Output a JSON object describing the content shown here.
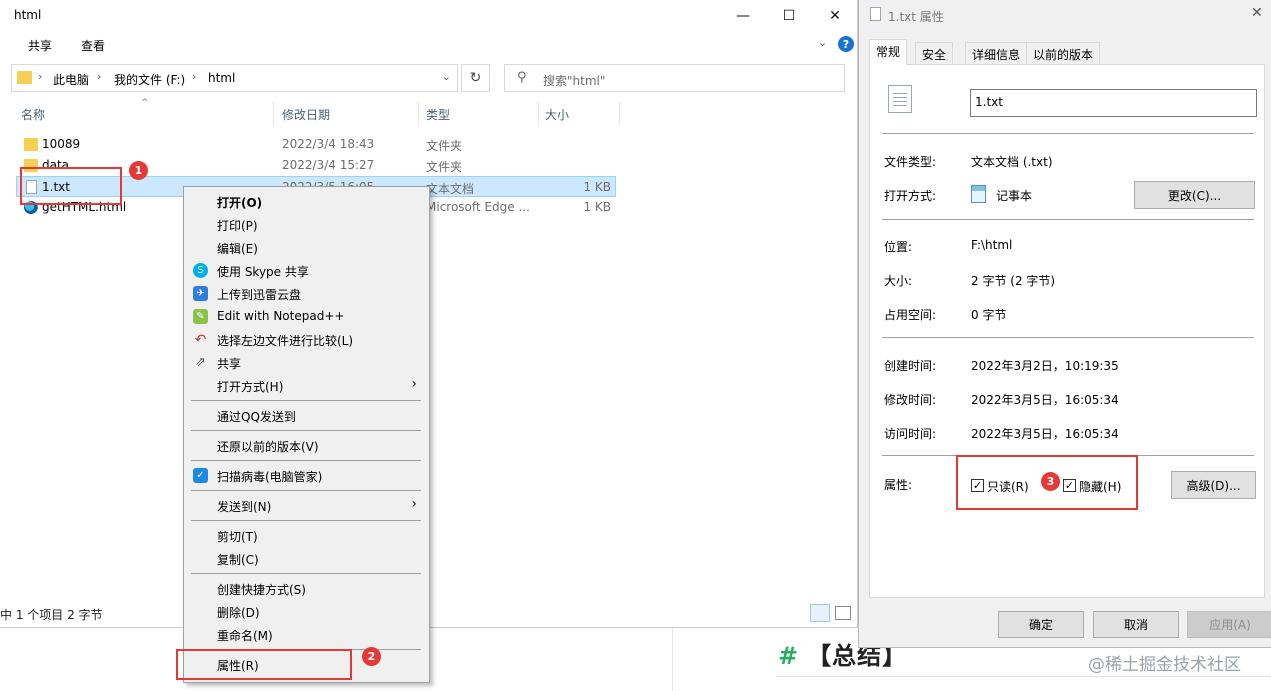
{
  "background": {
    "heading_hash": "#",
    "heading": "【总结】",
    "watermark": "@稀土掘金技术社区"
  },
  "explorer": {
    "title": "html",
    "window_controls": [
      "—",
      "☐",
      "✕"
    ],
    "ribbon_tabs": [
      "共享",
      "查看"
    ],
    "breadcrumb": [
      "此电脑",
      "我的文件 (F:)",
      "html"
    ],
    "search_placeholder": "搜索\"html\"",
    "columns": [
      "名称",
      "修改日期",
      "类型",
      "大小"
    ],
    "files": [
      {
        "name": "10089",
        "date": "2022/3/4 18:43",
        "type": "文件夹",
        "size": "",
        "icon": "folder-icon"
      },
      {
        "name": "data",
        "date": "2022/3/4 15:27",
        "type": "文件夹",
        "size": "",
        "icon": "folder-icon"
      },
      {
        "name": "1.txt",
        "date": "2022/3/5 16:05",
        "type": "文本文档",
        "size": "1 KB",
        "icon": "text-file-icon"
      },
      {
        "name": "getHTML.html",
        "date": "",
        "type": "Microsoft Edge ...",
        "size": "1 KB",
        "icon": "edge-icon"
      }
    ],
    "status": "中 1 个项目  2 字节"
  },
  "context_menu": {
    "items": [
      {
        "label": "打开(O)",
        "bold": true
      },
      {
        "label": "打印(P)"
      },
      {
        "label": "编辑(E)"
      },
      {
        "label": "使用 Skype 共享",
        "icon": "skype-icon",
        "color": "#00aff0"
      },
      {
        "label": "上传到迅雷云盘",
        "icon": "thunder-icon",
        "color": "#2f7de1"
      },
      {
        "label": "Edit with Notepad++",
        "icon": "notepad-plus-icon",
        "color": "#8bc34a"
      },
      {
        "label": "选择左边文件进行比较(L)",
        "icon": "compare-icon",
        "color": "#d32f2f"
      },
      {
        "label": "共享",
        "icon": "share-icon",
        "color": "#555555"
      },
      {
        "label": "打开方式(H)",
        "submenu": true
      },
      {
        "label": "通过QQ发送到"
      },
      {
        "label": "还原以前的版本(V)"
      },
      {
        "label": "扫描病毒(电脑管家)",
        "icon": "shield-icon",
        "color": "#1e88e5"
      },
      {
        "label": "发送到(N)",
        "submenu": true
      },
      {
        "label": "剪切(T)"
      },
      {
        "label": "复制(C)"
      },
      {
        "label": "创建快捷方式(S)"
      },
      {
        "label": "删除(D)"
      },
      {
        "label": "重命名(M)"
      },
      {
        "label": "属性(R)"
      }
    ]
  },
  "properties": {
    "title": "1.txt 属性",
    "tabs": [
      "常规",
      "安全",
      "详细信息",
      "以前的版本"
    ],
    "filename": "1.txt",
    "file_type_label": "文件类型:",
    "file_type": "文本文档 (.txt)",
    "open_with_label": "打开方式:",
    "open_with": "记事本",
    "change_button": "更改(C)...",
    "location_label": "位置:",
    "location": "F:\\html",
    "size_label": "大小:",
    "size": "2 字节 (2 字节)",
    "disk_label": "占用空间:",
    "disk": "0 字节",
    "created_label": "创建时间:",
    "created": "2022年3月2日，10:19:35",
    "modified_label": "修改时间:",
    "modified": "2022年3月5日，16:05:34",
    "accessed_label": "访问时间:",
    "accessed": "2022年3月5日，16:05:34",
    "attributes_label": "属性:",
    "readonly_label": "只读(R)",
    "readonly_checked": true,
    "hidden_label": "隐藏(H)",
    "hidden_checked": true,
    "advanced_button": "高级(D)...",
    "ok_button": "确定",
    "cancel_button": "取消",
    "apply_button": "应用(A)"
  },
  "annotations": [
    "1",
    "2",
    "3"
  ],
  "colors": {
    "accent": "#e53935",
    "selection": "#cce8ff"
  }
}
